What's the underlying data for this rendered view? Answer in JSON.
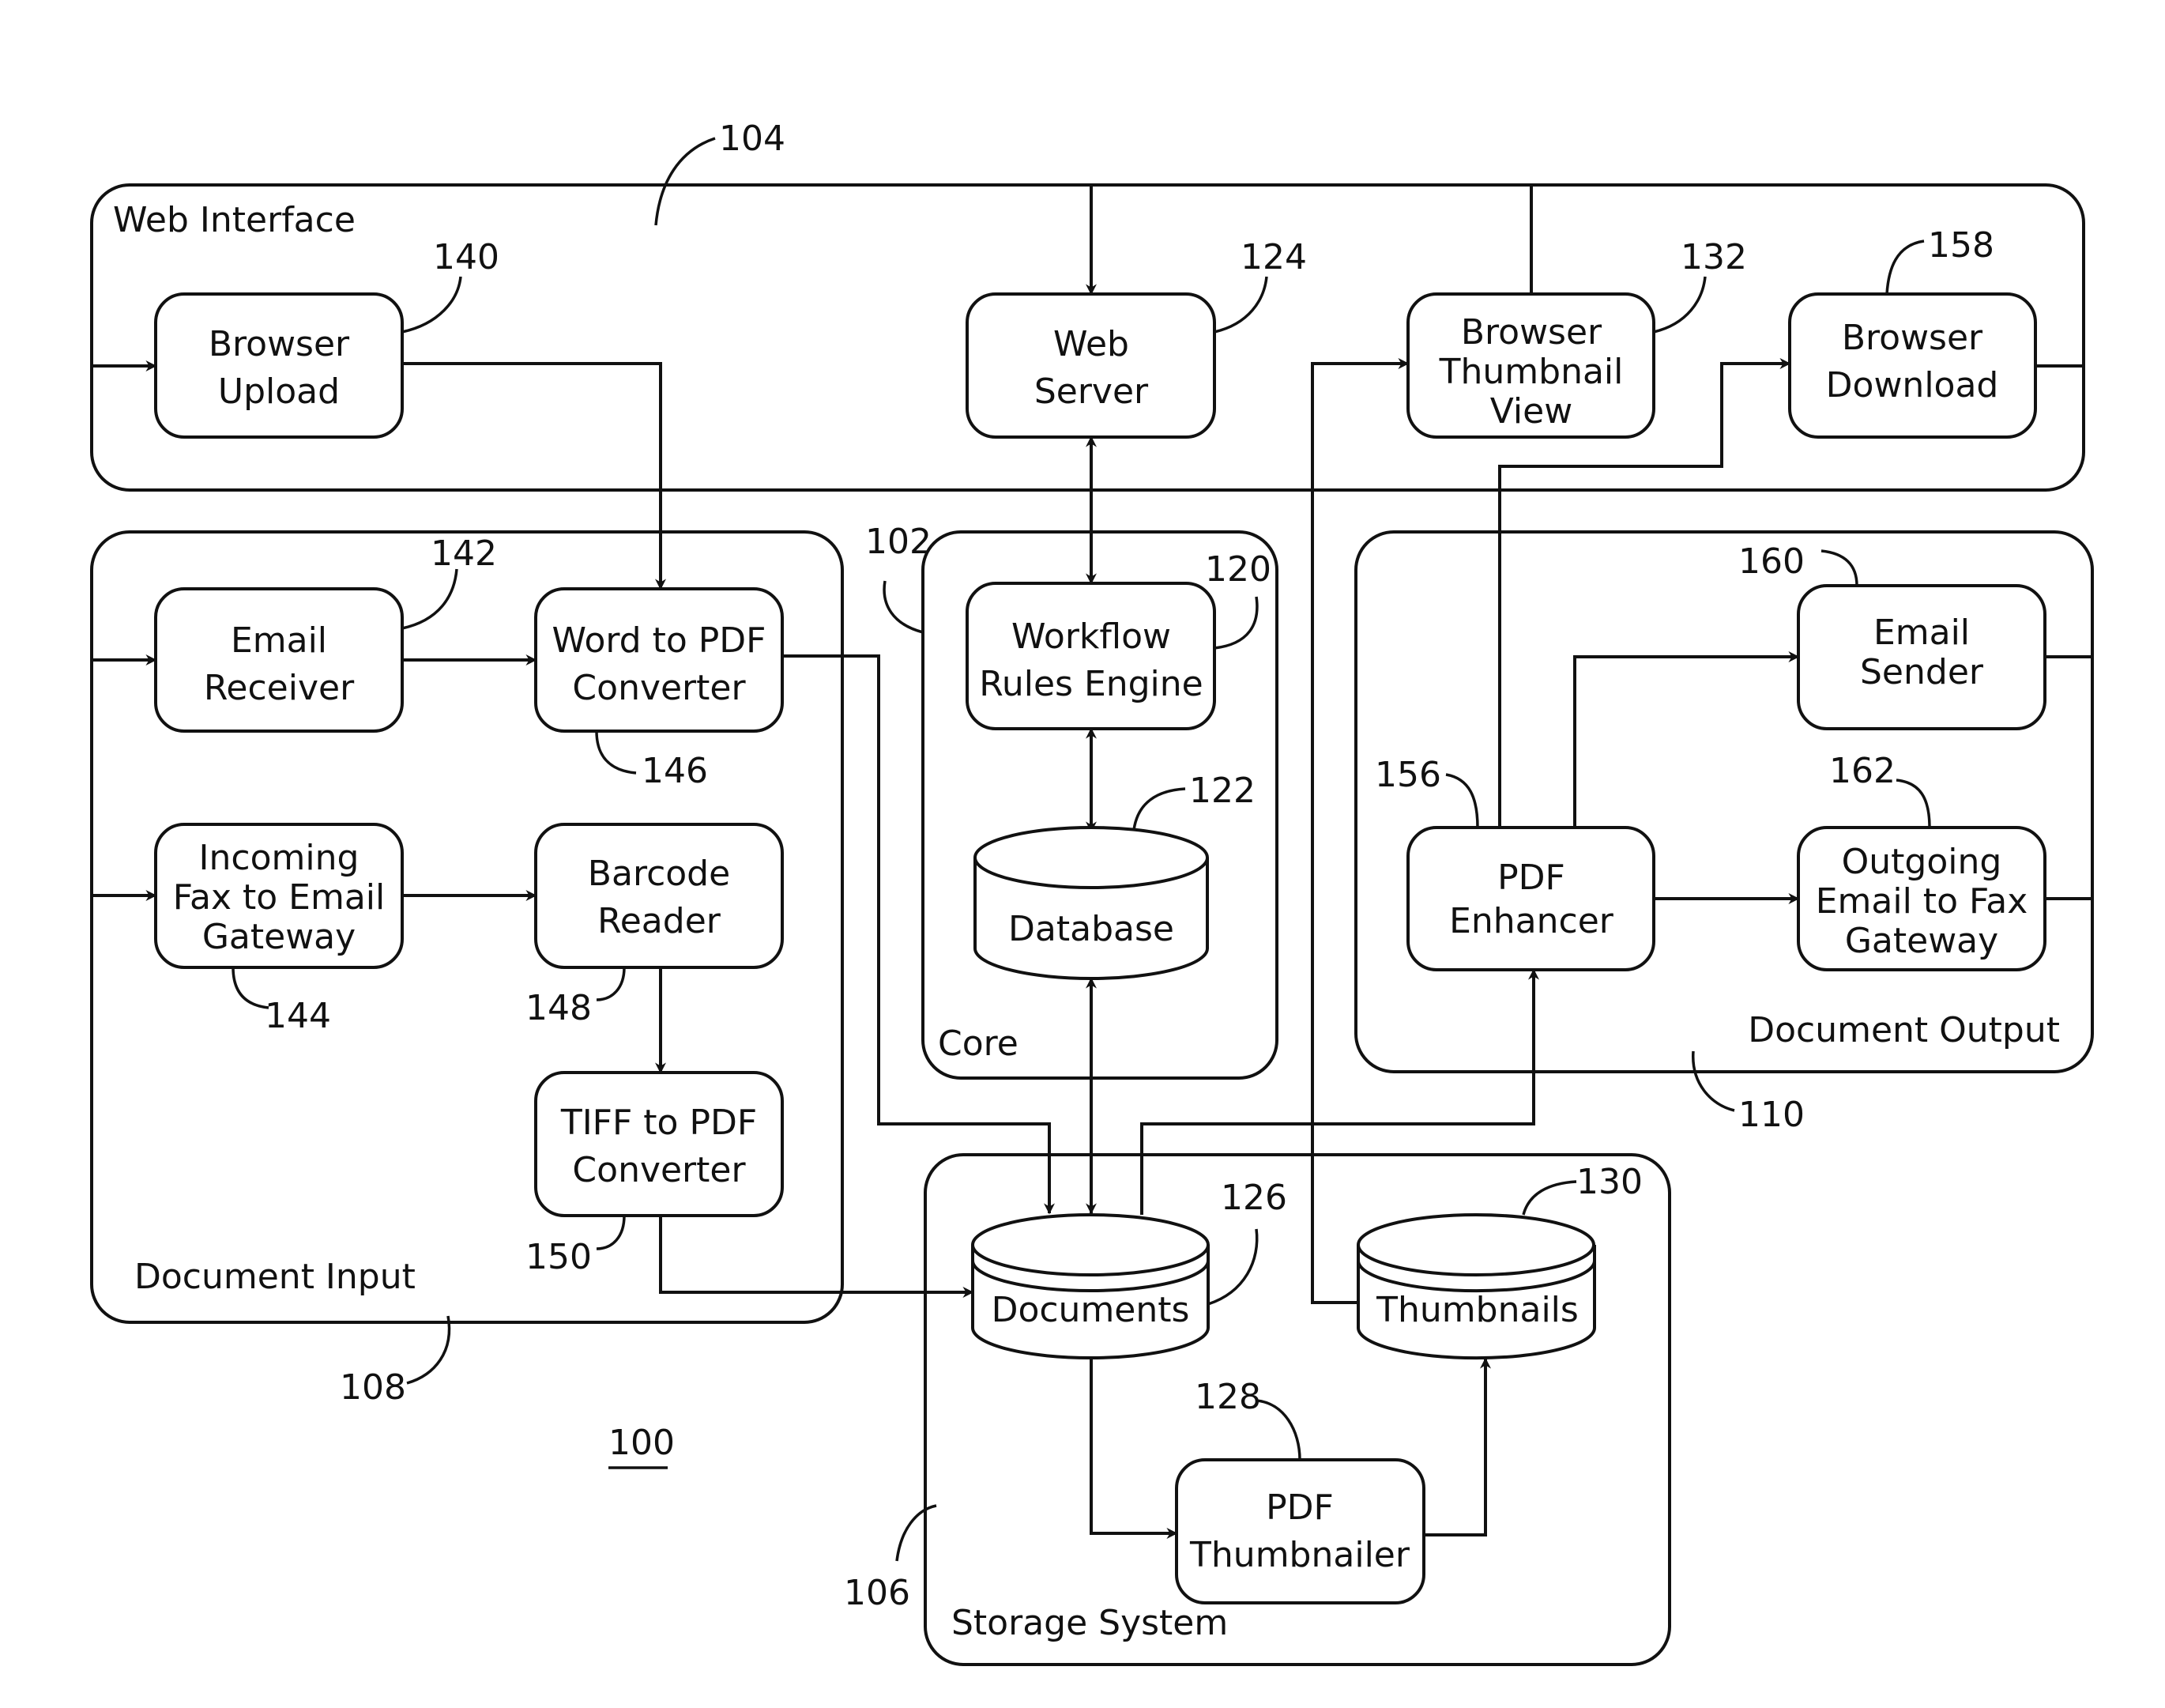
{
  "figure": {
    "reference": "100"
  },
  "groups": {
    "web_interface": {
      "label": "Web Interface",
      "ref": "104"
    },
    "document_input": {
      "label": "Document Input",
      "ref": "108"
    },
    "core": {
      "label": "Core",
      "ref": "102"
    },
    "document_output": {
      "label": "Document Output",
      "ref": "110"
    },
    "storage_system": {
      "label": "Storage System",
      "ref": "106"
    }
  },
  "nodes": {
    "browser_upload": {
      "lines": [
        "Browser",
        "Upload"
      ],
      "ref": "140"
    },
    "web_server": {
      "lines": [
        "Web",
        "Server"
      ],
      "ref": "124"
    },
    "browser_thumbnail_view": {
      "lines": [
        "Browser",
        "Thumbnail",
        "View"
      ],
      "ref": "132"
    },
    "browser_download": {
      "lines": [
        "Browser",
        "Download"
      ],
      "ref": "158"
    },
    "email_receiver": {
      "lines": [
        "Email",
        "Receiver"
      ],
      "ref": "142"
    },
    "word_to_pdf": {
      "lines": [
        "Word to PDF",
        "Converter"
      ],
      "ref": "146"
    },
    "incoming_fax": {
      "lines": [
        "Incoming",
        "Fax to Email",
        "Gateway"
      ],
      "ref": "144"
    },
    "barcode_reader": {
      "lines": [
        "Barcode",
        "Reader"
      ],
      "ref": "148"
    },
    "tiff_to_pdf": {
      "lines": [
        "TIFF to PDF",
        "Converter"
      ],
      "ref": "150"
    },
    "workflow_engine": {
      "lines": [
        "Workflow",
        "Rules Engine"
      ],
      "ref": "120"
    },
    "database": {
      "lines": [
        "Database"
      ],
      "ref": "122"
    },
    "pdf_enhancer": {
      "lines": [
        "PDF",
        "Enhancer"
      ],
      "ref": "156"
    },
    "email_sender": {
      "lines": [
        "Email",
        "Sender"
      ],
      "ref": "160"
    },
    "outgoing_fax": {
      "lines": [
        "Outgoing",
        "Email to Fax",
        "Gateway"
      ],
      "ref": "162"
    },
    "documents": {
      "lines": [
        "Documents"
      ],
      "ref": "126"
    },
    "thumbnails": {
      "lines": [
        "Thumbnails"
      ],
      "ref": "130"
    },
    "pdf_thumbnailer": {
      "lines": [
        "PDF",
        "Thumbnailer"
      ],
      "ref": "128"
    }
  },
  "edges": [
    {
      "from": "web_interface",
      "to": "browser_upload"
    },
    {
      "from": "web_interface",
      "to": "web_server"
    },
    {
      "from": "browser_upload",
      "to": "word_to_pdf"
    },
    {
      "from": "web_server",
      "to": "workflow_engine",
      "bidirectional": true
    },
    {
      "from": "workflow_engine",
      "to": "database",
      "bidirectional": true
    },
    {
      "from": "database",
      "to": "documents",
      "bidirectional": true
    },
    {
      "from": "thumbnails",
      "to": "browser_thumbnail_view"
    },
    {
      "from": "pdf_enhancer",
      "to": "browser_download"
    },
    {
      "from": "email_receiver",
      "to": "word_to_pdf"
    },
    {
      "from": "incoming_fax",
      "to": "barcode_reader"
    },
    {
      "from": "barcode_reader",
      "to": "tiff_to_pdf"
    },
    {
      "from": "word_to_pdf",
      "to": "documents"
    },
    {
      "from": "tiff_to_pdf",
      "to": "documents"
    },
    {
      "from": "documents",
      "to": "pdf_enhancer"
    },
    {
      "from": "pdf_enhancer",
      "to": "email_sender"
    },
    {
      "from": "pdf_enhancer",
      "to": "outgoing_fax"
    },
    {
      "from": "documents",
      "to": "pdf_thumbnailer"
    },
    {
      "from": "pdf_thumbnailer",
      "to": "thumbnails"
    }
  ]
}
